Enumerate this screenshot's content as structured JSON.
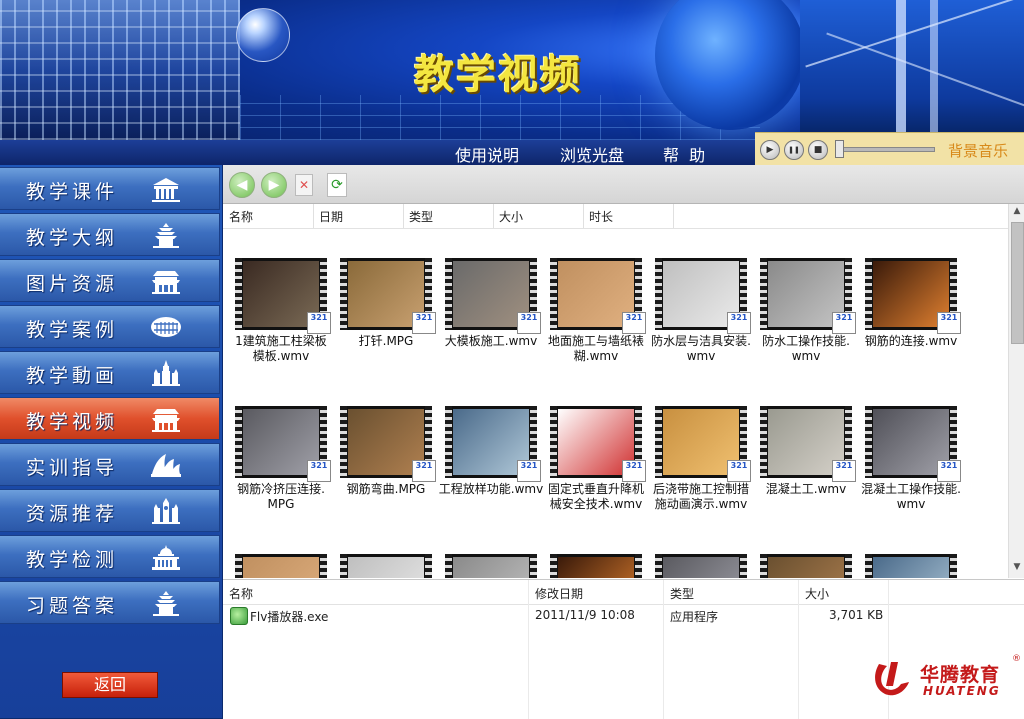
{
  "banner": {
    "title": "教学视频"
  },
  "nav": {
    "items": [
      "使用说明",
      "浏览光盘",
      "帮  助"
    ]
  },
  "player": {
    "bgm_label": "背景音乐",
    "play_icon": "▶",
    "pause_icon": "❚❚",
    "stop_icon": "■"
  },
  "sidebar": {
    "items": [
      {
        "label": "教学课件",
        "icon": "building-icon"
      },
      {
        "label": "教学大纲",
        "icon": "temple-icon"
      },
      {
        "label": "图片资源",
        "icon": "palace-icon"
      },
      {
        "label": "教学案例",
        "icon": "colosseum-icon"
      },
      {
        "label": "教学動画",
        "icon": "kremlin-icon"
      },
      {
        "label": "教学视频",
        "icon": "palace-icon",
        "active": true
      },
      {
        "label": "实训指导",
        "icon": "opera-house-icon"
      },
      {
        "label": "资源推荐",
        "icon": "cathedral-icon"
      },
      {
        "label": "教学检测",
        "icon": "capitol-icon"
      },
      {
        "label": "习题答案",
        "icon": "temple-icon"
      }
    ],
    "back_label": "返回"
  },
  "browser": {
    "toolbar": {
      "back_glyph": "◀",
      "forward_glyph": "▶",
      "delete_glyph": "✕",
      "refresh_glyph": "⟳"
    },
    "columns": [
      "名称",
      "日期",
      "类型",
      "大小",
      "时长"
    ],
    "badge_text": "321",
    "videos": [
      [
        "1建筑施工柱梁板",
        "模板.wmv"
      ],
      [
        "打钎.MPG"
      ],
      [
        "大模板施工.wmv"
      ],
      [
        "地面施工与墙纸裱",
        "糊.wmv"
      ],
      [
        "防水层与洁具安装.",
        "wmv"
      ],
      [
        "防水工操作技能.",
        "wmv"
      ],
      [
        "钢筋的连接.wmv"
      ],
      [
        "钢筋冷挤压连接.",
        "MPG"
      ],
      [
        "钢筋弯曲.MPG"
      ],
      [
        "工程放样功能.wmv"
      ],
      [
        "固定式垂直升降机",
        "械安全技术.wmv"
      ],
      [
        "后浇带施工控制措",
        "施动画演示.wmv"
      ],
      [
        "混凝土工.wmv"
      ],
      [
        "混凝土工操作技能.",
        "wmv"
      ]
    ],
    "bottom": {
      "columns": [
        "名称",
        "修改日期",
        "类型",
        "大小"
      ],
      "file": {
        "name": "Flv播放器.exe",
        "modified": "2011/11/9 10:08",
        "type": "应用程序",
        "size": "3,701 KB"
      }
    },
    "logo": {
      "cn": "华腾教育",
      "en": "HUATENG",
      "reg": "®"
    }
  },
  "colors": {
    "accent_active": "#e0502c",
    "menu_blue": "#3d6fc0",
    "title_yellow": "#f4e640",
    "logo_red": "#c41a1a"
  }
}
